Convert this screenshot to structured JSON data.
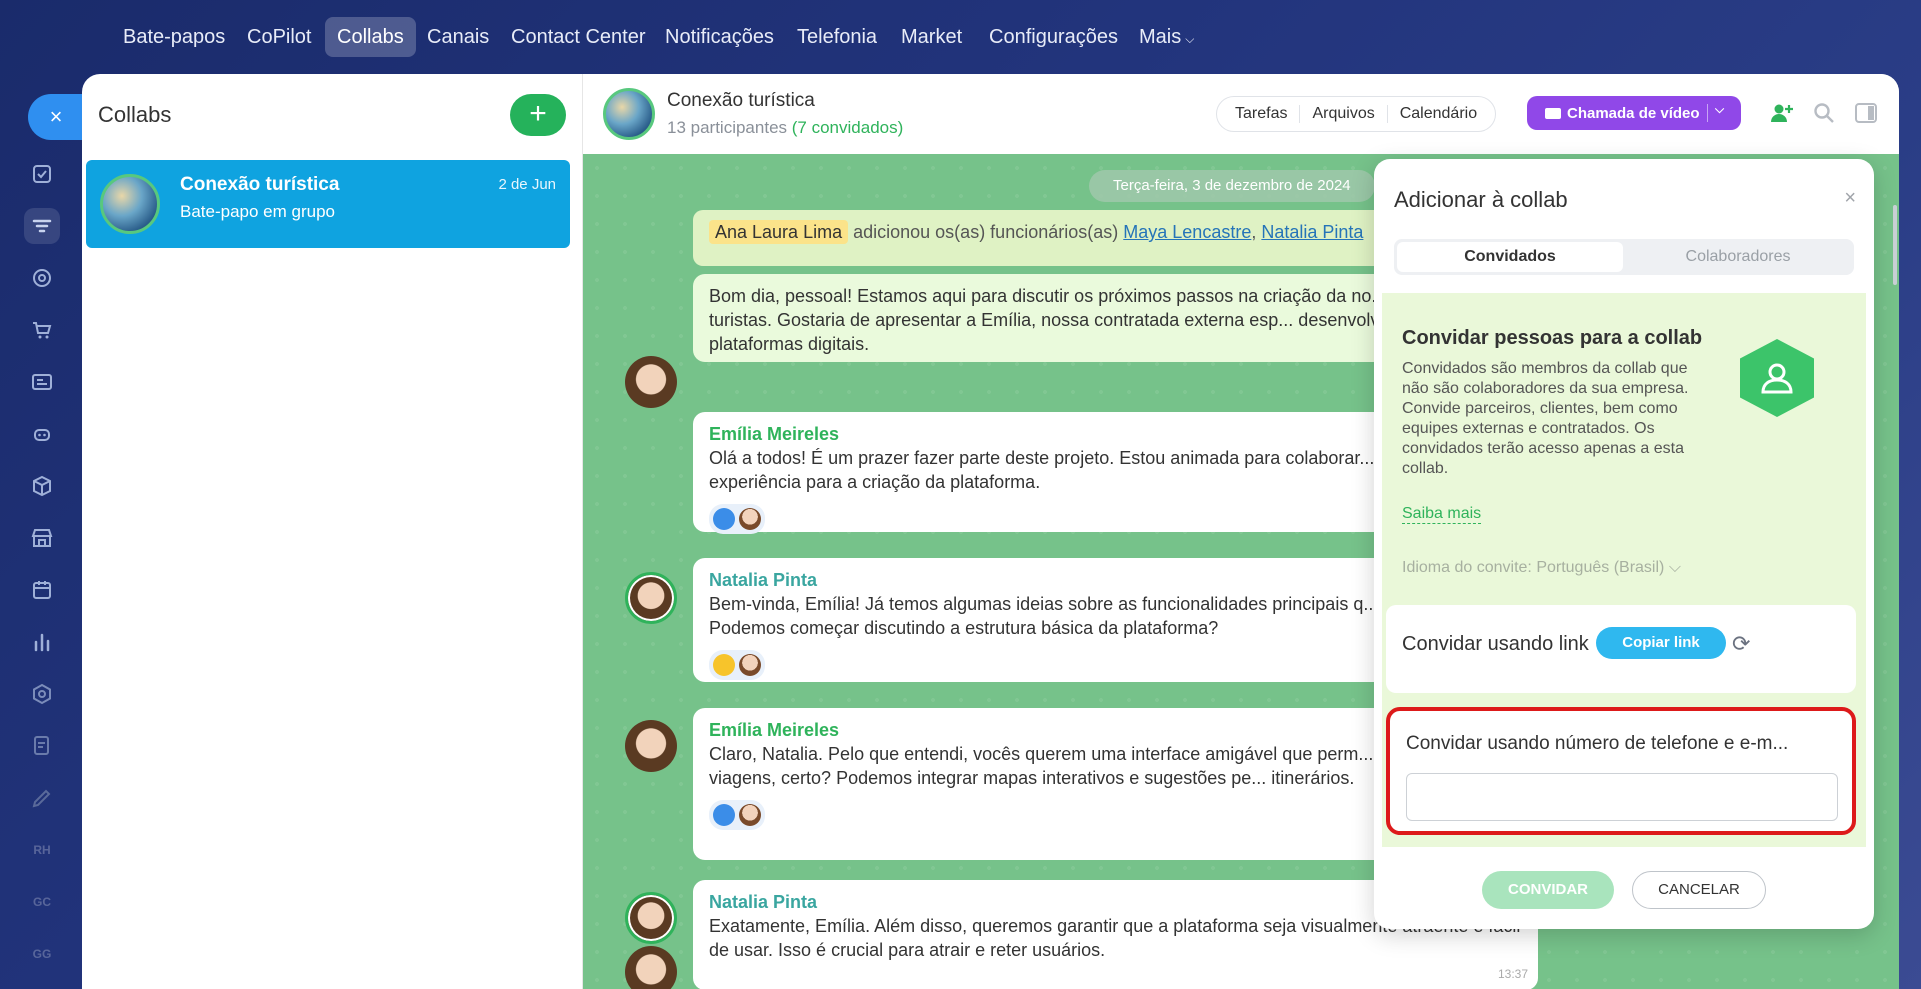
{
  "topnav": {
    "items": [
      "Bate-papos",
      "CoPilot",
      "Collabs",
      "Canais",
      "Contact Center",
      "Notificações",
      "Telefonia",
      "Market",
      "Configurações",
      "Mais"
    ],
    "active_index": 2
  },
  "sidebar_rail": {
    "close_glyph": "×",
    "text_icons": [
      "RH",
      "GC",
      "GG"
    ]
  },
  "collabs_list": {
    "title": "Collabs",
    "add_glyph": "+",
    "items": [
      {
        "name": "Conexão turística",
        "subtitle": "Bate-papo em grupo",
        "date": "2 de Jun"
      }
    ]
  },
  "chat": {
    "header": {
      "name": "Conexão turística",
      "participants": "13 participantes",
      "guests": "(7 convidados)",
      "tabs": [
        "Tarefas",
        "Arquivos",
        "Calendário"
      ],
      "video_button": "Chamada de vídeo"
    },
    "date_divider": "Terça-feira, 3 de dezembro de 2024",
    "system_message": {
      "actor": "Ana Laura Lima",
      "text": "adicionou os(as) funcionários(as)",
      "links": [
        "Maya Lencastre",
        "Natalia Pinta"
      ]
    },
    "messages": [
      {
        "author": "",
        "text": "Bom dia, pessoal! Estamos aqui para discutir os próximos passos na criação da no... online para turistas. Gostaria de apresentar a Emília, nossa contratada externa esp... desenvolvimento de plataformas digitais."
      },
      {
        "author": "Emília Meireles",
        "text": "Olá a todos! É um prazer fazer parte deste projeto. Estou animada para colaborar... minha experiência para a criação da plataforma."
      },
      {
        "author": "Natalia Pinta",
        "text": "Bem-vinda, Emília! Já temos algumas ideias sobre as funcionalidades principais q... implementar. Podemos começar discutindo a estrutura básica da plataforma?"
      },
      {
        "author": "Emília Meireles",
        "text": "Claro, Natalia. Pelo que entendi, vocês querem uma interface amigável que perm... planejar suas viagens, certo? Podemos integrar mapas interativos e sugestões pe... itinerários."
      },
      {
        "author": "Natalia Pinta",
        "text": "Exatamente, Emília. Além disso, queremos garantir que a plataforma seja visualmente atraente e fácil de usar. Isso é crucial para atrair e reter usuários.",
        "time": "13:37"
      }
    ]
  },
  "popup": {
    "title": "Adicionar à collab",
    "close_glyph": "×",
    "tabs": [
      "Convidados",
      "Colaboradores"
    ],
    "invite_title": "Convidar pessoas para a collab",
    "invite_text": "Convidados são membros da collab que não são colaboradores da sua empresa. Convide parceiros, clientes, bem como equipes externas e contratados. Os convidados terão acesso apenas a esta collab.",
    "learn_more": "Saiba mais",
    "language_label": "Idioma do convite:",
    "language_value": "Português (Brasil)",
    "link_label": "Convidar usando link",
    "copy_link": "Copiar link",
    "phone_label": "Convidar usando número de telefone e e-m...",
    "phone_value": "",
    "invite_button": "CONVIDAR",
    "cancel_button": "CANCELAR"
  }
}
